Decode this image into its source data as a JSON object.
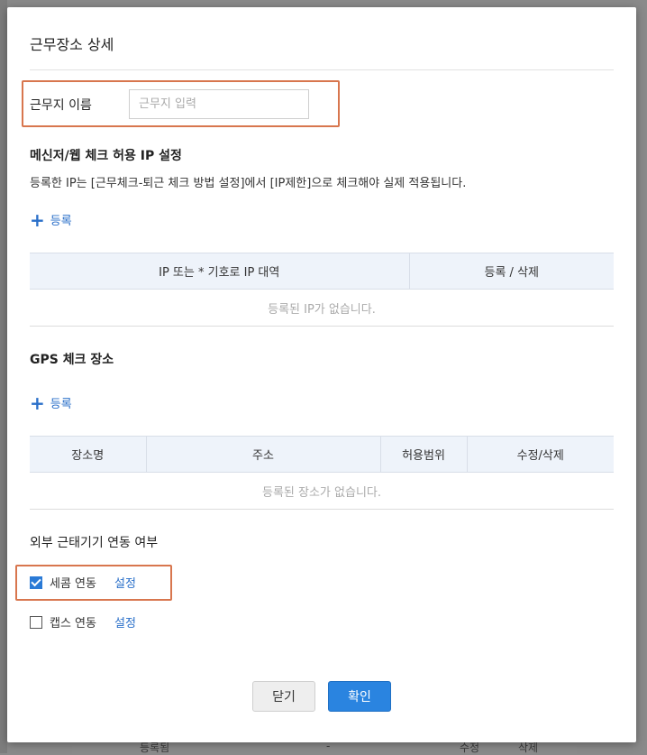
{
  "modal": {
    "title": "근무장소 상세"
  },
  "work_name": {
    "label": "근무지 이름",
    "value": "",
    "placeholder": "근무지 입력"
  },
  "ip_section": {
    "title": "메신저/웹 체크 허용 IP 설정",
    "description": "등록한 IP는 [근무체크-퇴근 체크 방법 설정]에서 [IP제한]으로 체크해야 실제 적용됩니다.",
    "add_label": "등록",
    "columns": [
      "IP 또는 * 기호로 IP 대역",
      "등록 / 삭제"
    ],
    "empty_text": "등록된 IP가 없습니다."
  },
  "gps_section": {
    "title": "GPS 체크 장소",
    "add_label": "등록",
    "columns": [
      "장소명",
      "주소",
      "허용범위",
      "수정/삭제"
    ],
    "empty_text": "등록된 장소가 없습니다."
  },
  "external_section": {
    "title": "외부 근태기기 연동 여부",
    "items": [
      {
        "label": "세콤 연동",
        "checked": true,
        "link": "설정"
      },
      {
        "label": "캡스 연동",
        "checked": false,
        "link": "설정"
      }
    ]
  },
  "buttons": {
    "close": "닫기",
    "confirm": "확인"
  },
  "background": {
    "row_left": "등록됨",
    "row_mid": "-",
    "row_edit": "수정",
    "row_delete": "삭제"
  },
  "colors": {
    "accent": "#2a84e0",
    "link": "#2a6fc9",
    "highlight": "#d8764e",
    "header_bg": "#eef3fa"
  }
}
